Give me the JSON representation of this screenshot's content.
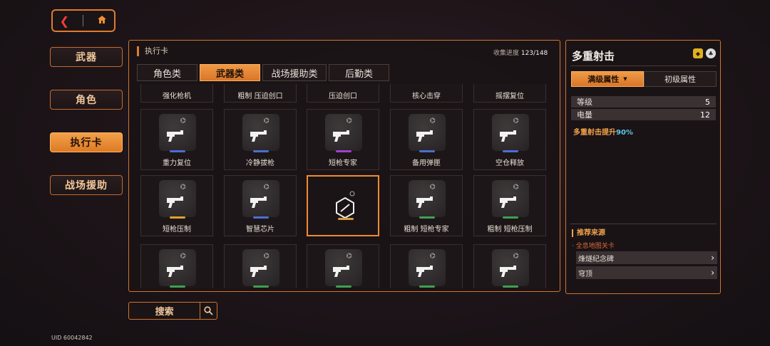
{
  "nav": {
    "back_icon": "back-arrow-icon",
    "home_icon": "home-icon"
  },
  "left_menu": [
    {
      "label": "武器",
      "active": false
    },
    {
      "label": "角色",
      "active": false
    },
    {
      "label": "执行卡",
      "active": true
    },
    {
      "label": "战场援助",
      "active": false
    }
  ],
  "panel": {
    "title": "执行卡",
    "progress_label": "收集进度",
    "progress_value": "123/148",
    "tabs": [
      {
        "label": "角色类",
        "active": false
      },
      {
        "label": "武器类",
        "active": true
      },
      {
        "label": "战场援助类",
        "active": false
      },
      {
        "label": "后勤类",
        "active": false
      }
    ]
  },
  "cards_top": [
    "强化枪机",
    "粗制 压迫创口",
    "压迫创口",
    "核心击穿",
    "摇摆复位"
  ],
  "cards": [
    {
      "name": "重力复位",
      "rarity": "#4a6fd0"
    },
    {
      "name": "冷静拔枪",
      "rarity": "#4a6fd0"
    },
    {
      "name": "短枪专家",
      "rarity": "#a040d0"
    },
    {
      "name": "备用弹匣",
      "rarity": "#4a6fd0"
    },
    {
      "name": "空仓释放",
      "rarity": "#4a6fd0"
    },
    {
      "name": "短枪压制",
      "rarity": "#e0a030"
    },
    {
      "name": "智慧芯片",
      "rarity": "#4a6fd0"
    },
    {
      "name": "",
      "rarity": "",
      "selected": true
    },
    {
      "name": "粗制 短枪专家",
      "rarity": "#40a050"
    },
    {
      "name": "粗制 短枪压制",
      "rarity": "#40a050"
    },
    {
      "name": "",
      "rarity": "#40a050"
    },
    {
      "name": "",
      "rarity": "#40a050"
    },
    {
      "name": "",
      "rarity": "#40a050"
    },
    {
      "name": "",
      "rarity": "#40a050"
    },
    {
      "name": "",
      "rarity": "#40a050"
    }
  ],
  "search": {
    "label": "搜索",
    "icon": "search-icon"
  },
  "uid": "UID 60042842",
  "detail": {
    "title": "多重射击",
    "attr_tabs": [
      {
        "label": "满级属性",
        "active": true
      },
      {
        "label": "初级属性",
        "active": false
      }
    ],
    "stats": [
      {
        "label": "等级",
        "value": "5"
      },
      {
        "label": "电量",
        "value": "12"
      }
    ],
    "effect_text": "多重射击提升",
    "effect_value": "90%",
    "recommend_title": "推荐来源",
    "recommend_sub": "· 全息地图关卡",
    "recommend_items": [
      "烽燧纪念碑",
      "穹顶"
    ]
  },
  "colors": {
    "accent": "#e07a2e",
    "selected_orange": "#f08a34",
    "effect_blue": "#5ec8e8"
  }
}
